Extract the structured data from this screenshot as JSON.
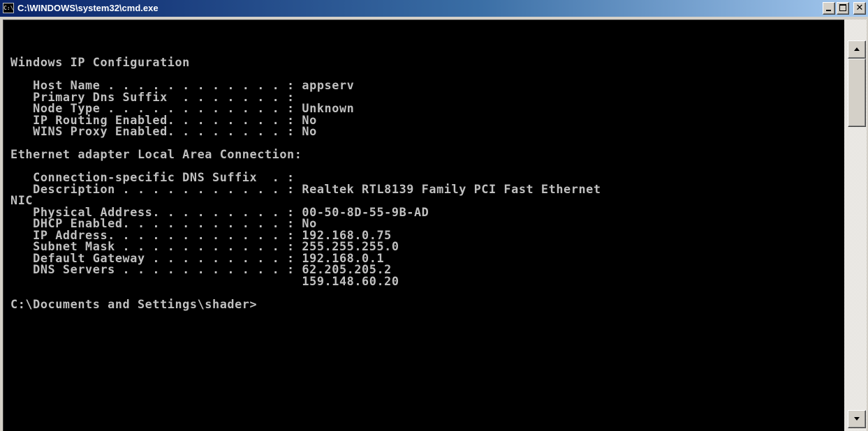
{
  "window": {
    "title": "C:\\WINDOWS\\system32\\cmd.exe",
    "icon_label": "C:\\",
    "controls": {
      "minimize": "minimize-icon",
      "maximize": "maximize-icon",
      "close": "✕"
    }
  },
  "console": {
    "lines": [
      "Windows IP Configuration",
      "",
      "   Host Name . . . . . . . . . . . . : appserv",
      "   Primary Dns Suffix  . . . . . . . :",
      "   Node Type . . . . . . . . . . . . : Unknown",
      "   IP Routing Enabled. . . . . . . . : No",
      "   WINS Proxy Enabled. . . . . . . . : No",
      "",
      "Ethernet adapter Local Area Connection:",
      "",
      "   Connection-specific DNS Suffix  . :",
      "   Description . . . . . . . . . . . : Realtek RTL8139 Family PCI Fast Ethernet",
      "NIC",
      "   Physical Address. . . . . . . . . : 00-50-8D-55-9B-AD",
      "   DHCP Enabled. . . . . . . . . . . : No",
      "   IP Address. . . . . . . . . . . . : 192.168.0.75",
      "   Subnet Mask . . . . . . . . . . . : 255.255.255.0",
      "   Default Gateway . . . . . . . . . : 192.168.0.1",
      "   DNS Servers . . . . . . . . . . . : 62.205.205.2",
      "                                       159.148.60.20",
      "",
      "C:\\Documents and Settings\\shader>"
    ],
    "colors": {
      "background": "#000000",
      "foreground": "#c0c0c0"
    }
  },
  "scrollbar": {
    "up_icon": "scroll-up-arrow-icon",
    "down_icon": "scroll-down-arrow-icon"
  }
}
